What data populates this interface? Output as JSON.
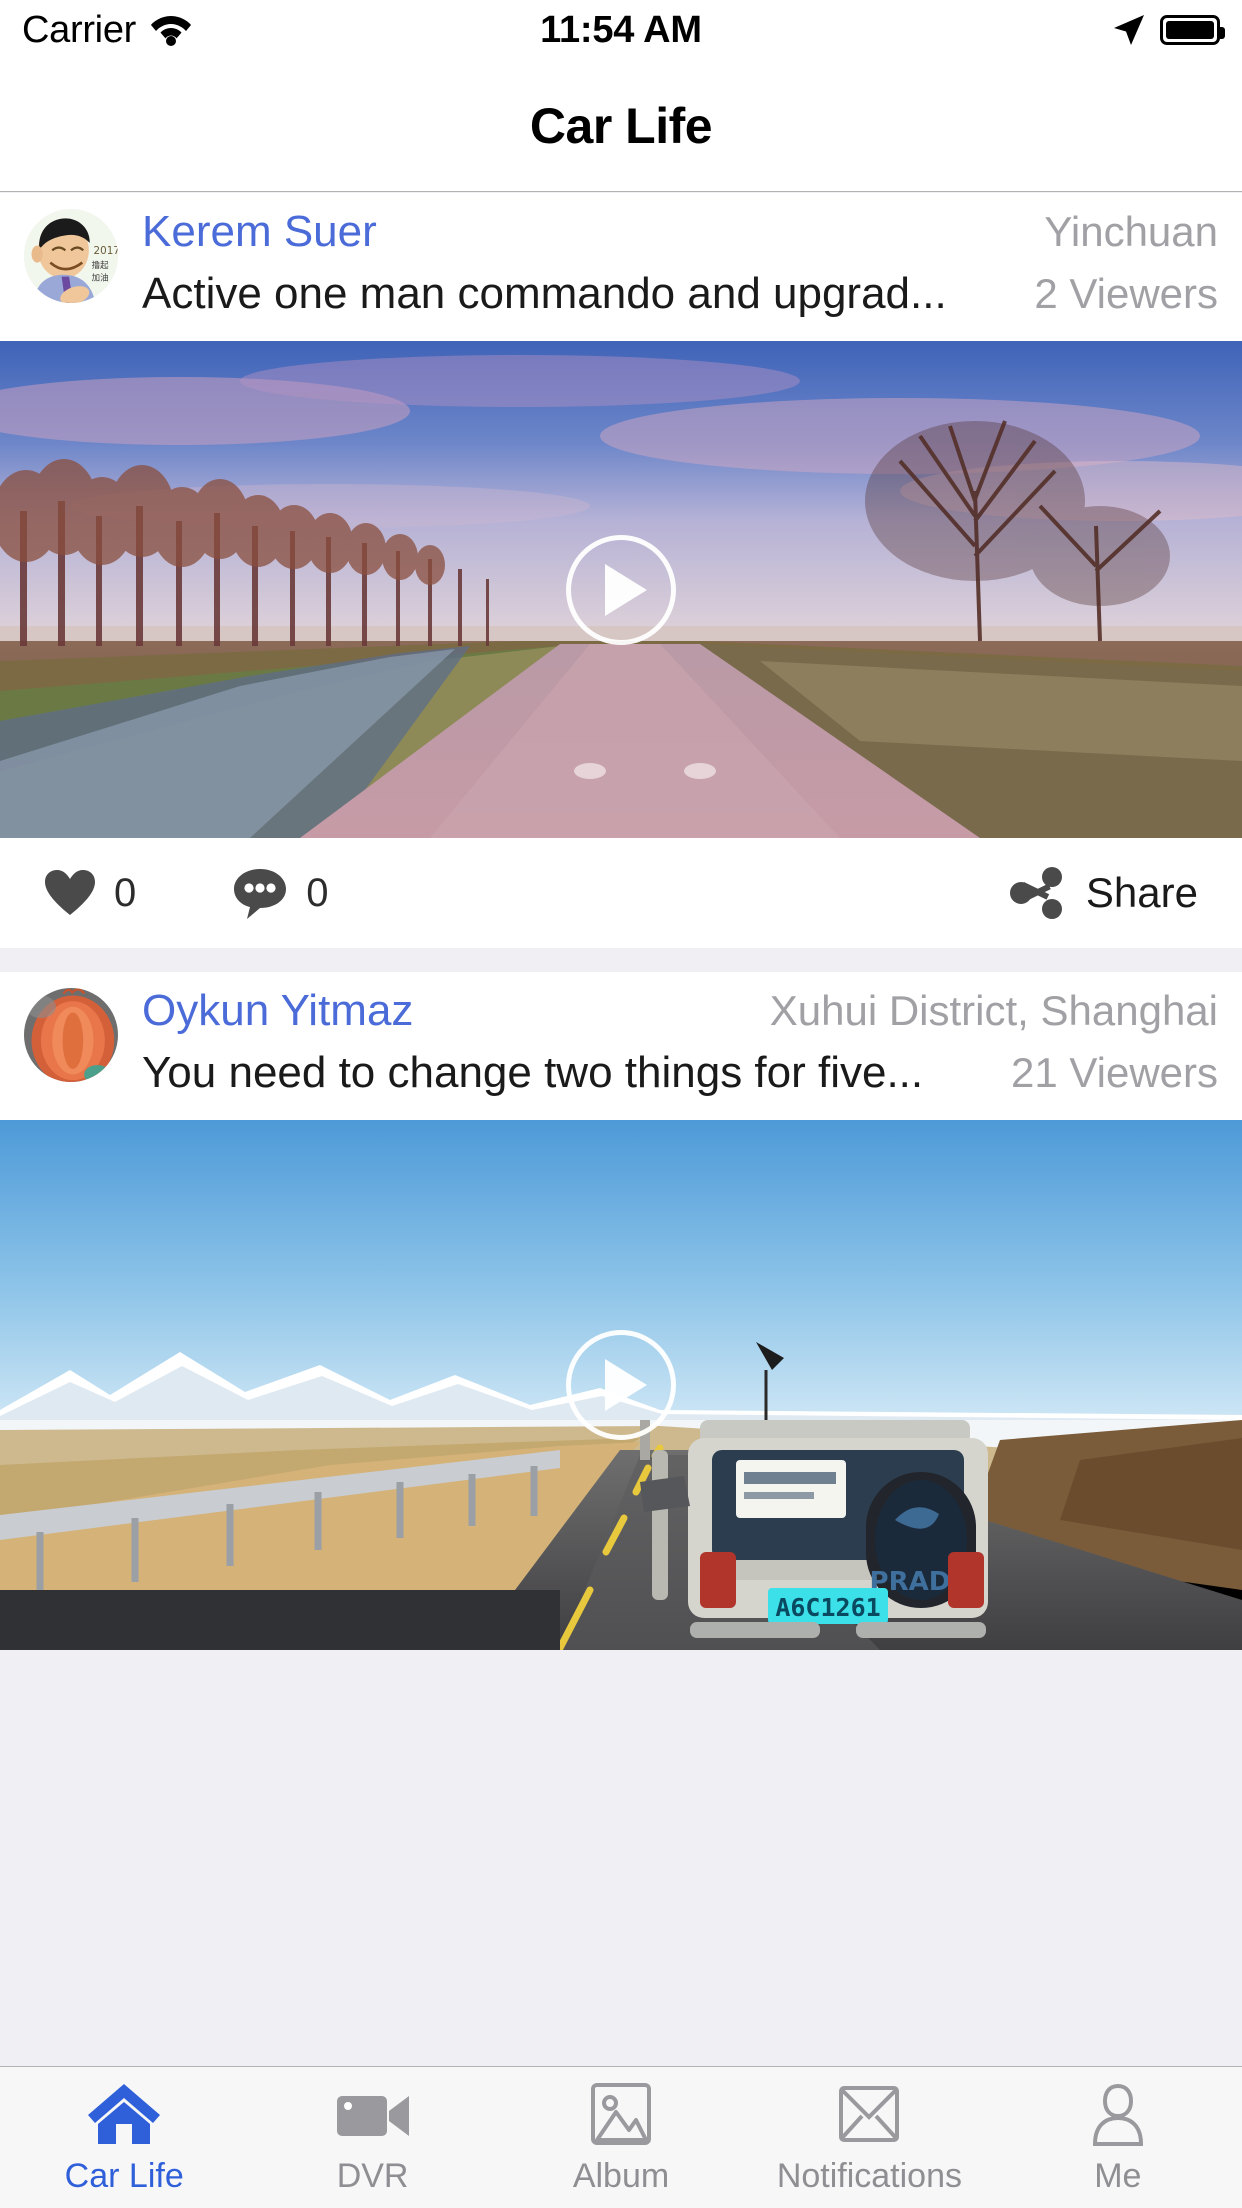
{
  "status_bar": {
    "carrier": "Carrier",
    "wifi_icon": "wifi-icon",
    "time": "11:54 AM",
    "location_icon": "location-arrow-icon",
    "battery_icon": "battery-full-icon"
  },
  "navbar": {
    "title": "Car Life"
  },
  "posts": [
    {
      "avatar_name": "avatar-kerem-suer",
      "username": "Kerem Suer",
      "location": "Yinchuan",
      "caption": "Active one man commando and upgrad...",
      "viewers": "2 Viewers",
      "media_name": "video-thumbnail-sunset-road",
      "play_icon": "play-icon",
      "likes": "0",
      "comments": "0",
      "share_label": "Share",
      "like_icon": "heart-icon",
      "comment_icon": "comment-bubble-icon",
      "share_icon": "share-icon"
    },
    {
      "avatar_name": "avatar-oykun-yitmaz",
      "username": "Oykun Yitmaz",
      "location": "Xuhui District,  Shanghai",
      "caption": "You need to change two things for five...",
      "viewers": "21 Viewers",
      "media_name": "video-thumbnail-prado-highland-road",
      "play_icon": "play-icon"
    }
  ],
  "tabbar": {
    "items": [
      {
        "label": "Car Life",
        "icon": "home-icon",
        "active": true
      },
      {
        "label": "DVR",
        "icon": "video-camera-icon",
        "active": false
      },
      {
        "label": "Album",
        "icon": "photo-icon",
        "active": false
      },
      {
        "label": "Notifications",
        "icon": "envelope-icon",
        "active": false
      },
      {
        "label": "Me",
        "icon": "person-icon",
        "active": false
      }
    ]
  },
  "colors": {
    "accent_blue": "#2f5fd9",
    "username_blue": "#4a6bd8",
    "muted_gray": "#a0a0a5",
    "tab_inactive": "#8e8e93",
    "background": "#efeff4"
  }
}
